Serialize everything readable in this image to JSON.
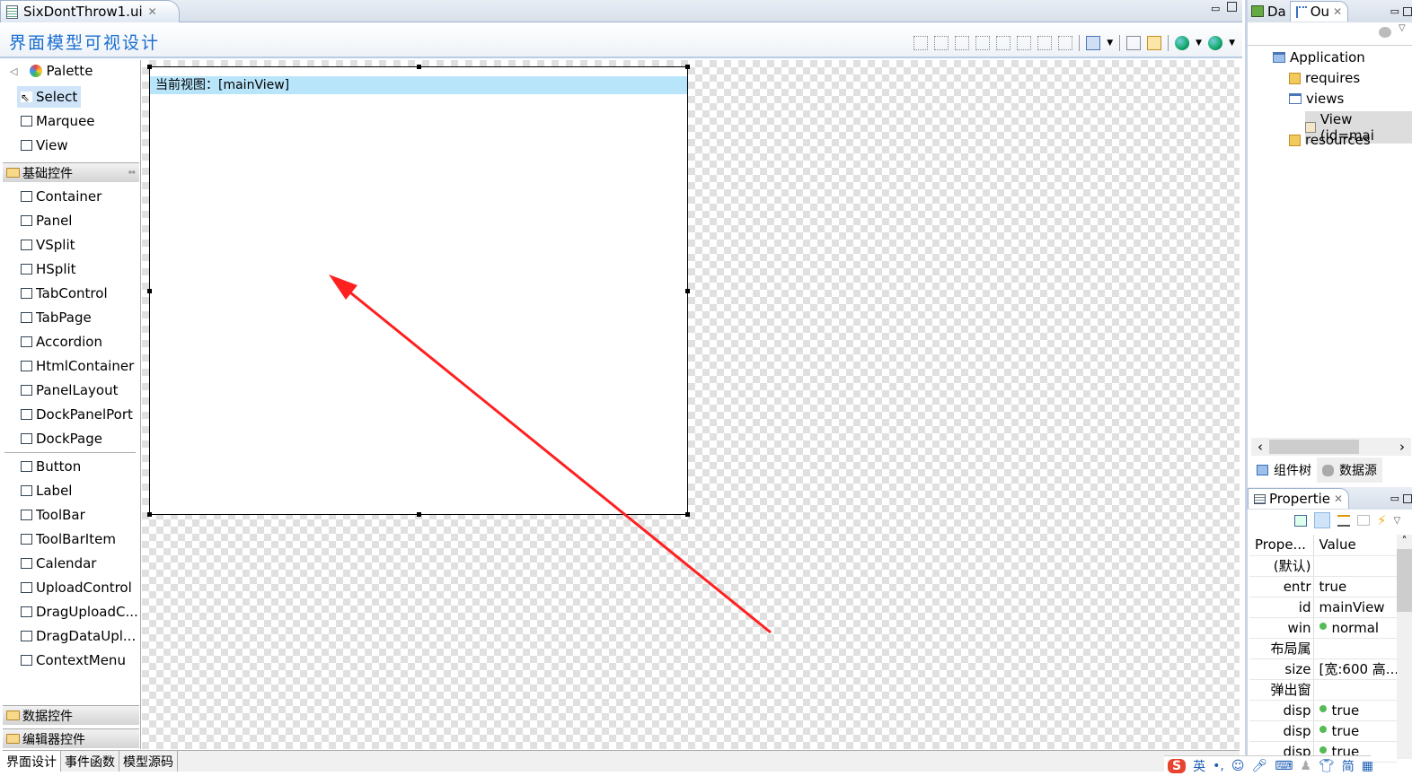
{
  "editor": {
    "tab_title": "SixDontThrow1.ui",
    "title": "界面模型可视设计"
  },
  "palette": {
    "header": "Palette",
    "tools": [
      "Select",
      "Marquee",
      "View"
    ],
    "group_basic": "基础控件",
    "basic": [
      "Container",
      "Panel",
      "VSplit",
      "HSplit",
      "TabControl",
      "TabPage",
      "Accordion",
      "HtmlContainer",
      "PanelLayout",
      "DockPanelPort",
      "DockPage"
    ],
    "widgets": [
      "Button",
      "Label",
      "ToolBar",
      "ToolBarItem",
      "Calendar",
      "UploadControl",
      "DragUploadC...",
      "DragDataUpl...",
      "ContextMenu"
    ],
    "group_data": "数据控件",
    "group_editor": "编辑器控件"
  },
  "canvas": {
    "view_label": "当前视图：[mainView]",
    "annotation_color": "#ff2020"
  },
  "bottom_tabs": [
    "界面设计",
    "事件函数",
    "模型源码"
  ],
  "outline": {
    "tab_da": "Da",
    "tab_ou": "Ou",
    "tree": [
      {
        "label": "Application",
        "icon": "application-icon"
      },
      {
        "label": "requires",
        "icon": "package-icon"
      },
      {
        "label": "views",
        "icon": "views-icon"
      },
      {
        "label": "View (id=mai",
        "icon": "view-icon"
      },
      {
        "label": "resources",
        "icon": "package-icon"
      }
    ],
    "bottom_tabs": [
      "组件树",
      "数据源"
    ]
  },
  "properties": {
    "title": "Propertie",
    "col_prop": "Prope...",
    "col_value": "Value",
    "rows": [
      {
        "p": "(默认)",
        "v": "",
        "dot": false
      },
      {
        "p": "entr",
        "v": "true",
        "dot": false
      },
      {
        "p": "id",
        "v": "mainView",
        "dot": false
      },
      {
        "p": "win",
        "v": "normal",
        "dot": true
      },
      {
        "p": "布局属",
        "v": "",
        "dot": false
      },
      {
        "p": "size",
        "v": "[宽:600 高...",
        "dot": false
      },
      {
        "p": "弹出窗",
        "v": "",
        "dot": false
      },
      {
        "p": "disp",
        "v": "true",
        "dot": true
      },
      {
        "p": "disp",
        "v": "true",
        "dot": true
      },
      {
        "p": "disp",
        "v": "true",
        "dot": true
      }
    ]
  },
  "ime": {
    "lang": "英",
    "simp": "简"
  }
}
